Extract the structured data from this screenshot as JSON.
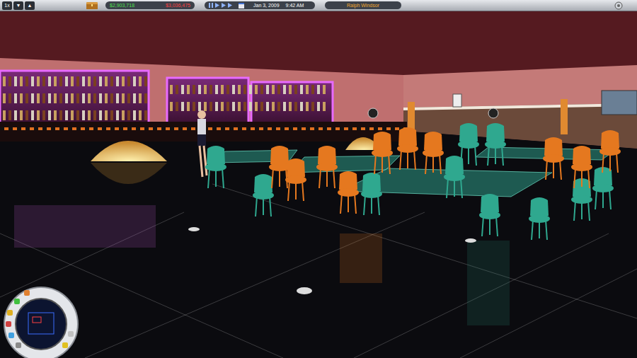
{
  "toolbar": {
    "speed_buttons": [
      "1x",
      "▼",
      "▲"
    ],
    "cash": "$2,903,718",
    "expenses": "$3,036,475",
    "date": "Jan 3, 2009",
    "time": "9:42 AM",
    "player": "Ralph Windsor"
  }
}
